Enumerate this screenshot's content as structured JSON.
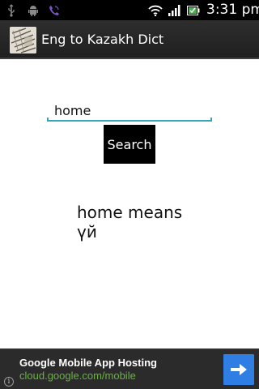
{
  "status_bar": {
    "time": "3:31 pm",
    "icons": [
      "usb-icon",
      "android-icon",
      "phone-icon",
      "wifi-icon",
      "signal-icon",
      "battery-icon"
    ]
  },
  "action_bar": {
    "title": "Eng to Kazakh Dict",
    "app_icon": "dictionary-app-icon"
  },
  "search": {
    "value": "home",
    "button_label": "Search"
  },
  "result": {
    "text": "home means үй"
  },
  "ad": {
    "title": "Google Mobile App Hosting",
    "url": "cloud.google.com/mobile",
    "arrow_icon": "arrow-right-icon",
    "info_icon": "info-icon",
    "arrow_button_color": "#2f7ee4",
    "url_color": "#69b243"
  },
  "colors": {
    "input_underline": "#33a6c4",
    "action_bar": "#262626"
  }
}
